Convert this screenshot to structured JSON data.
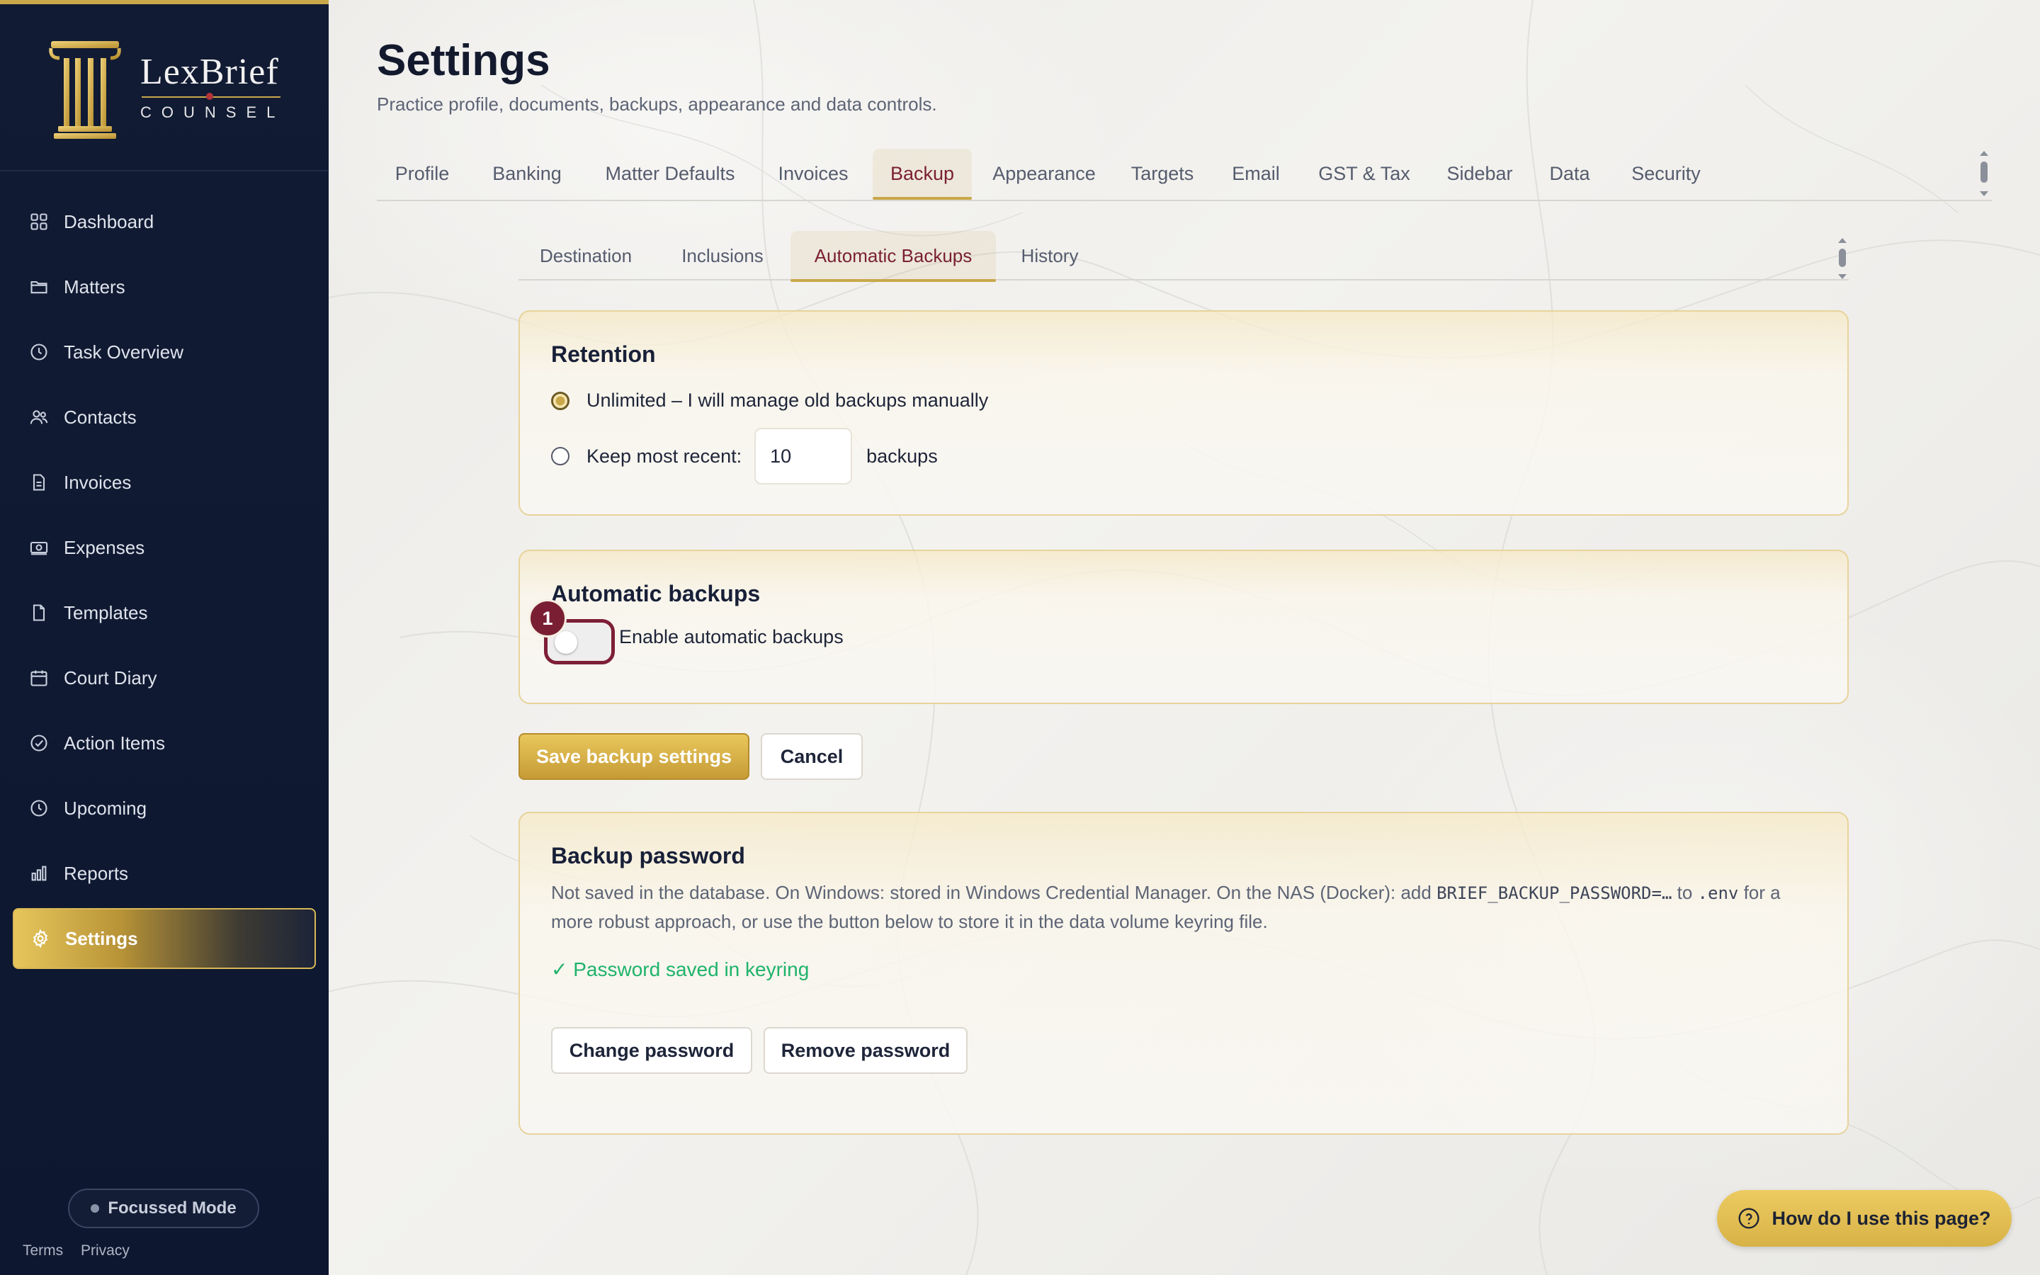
{
  "brand": {
    "name": "LexBrief",
    "sub": "COUNSEL"
  },
  "sidebar": {
    "items": [
      {
        "label": "Dashboard",
        "icon": "grid-icon"
      },
      {
        "label": "Matters",
        "icon": "folder-icon"
      },
      {
        "label": "Task Overview",
        "icon": "clock-icon"
      },
      {
        "label": "Contacts",
        "icon": "users-icon"
      },
      {
        "label": "Invoices",
        "icon": "document-icon"
      },
      {
        "label": "Expenses",
        "icon": "cash-icon"
      },
      {
        "label": "Templates",
        "icon": "file-icon"
      },
      {
        "label": "Court Diary",
        "icon": "calendar-icon"
      },
      {
        "label": "Action Items",
        "icon": "check-circle-icon"
      },
      {
        "label": "Upcoming",
        "icon": "clock-icon"
      },
      {
        "label": "Reports",
        "icon": "bar-chart-icon"
      },
      {
        "label": "Settings",
        "icon": "gear-icon",
        "active": true
      }
    ],
    "focus_mode": "Focussed Mode",
    "terms": "Terms",
    "privacy": "Privacy"
  },
  "header": {
    "title": "Settings",
    "subtitle": "Practice profile, documents, backups, appearance and data controls."
  },
  "tabs": [
    "Profile",
    "Banking",
    "Matter Defaults",
    "Invoices",
    "Backup",
    "Appearance",
    "Targets",
    "Email",
    "GST & Tax",
    "Sidebar",
    "Data",
    "Security"
  ],
  "active_tab": "Backup",
  "subtabs": [
    "Destination",
    "Inclusions",
    "Automatic Backups",
    "History"
  ],
  "active_subtab": "Automatic Backups",
  "retention": {
    "title": "Retention",
    "option_unlimited": "Unlimited – I will manage old backups manually",
    "option_keep": "Keep most recent:",
    "keep_value": "10",
    "keep_suffix": "backups",
    "selected": "unlimited"
  },
  "auto": {
    "title": "Automatic backups",
    "toggle_label": "Enable automatic backups",
    "enabled": false,
    "badge": "1"
  },
  "actions": {
    "save": "Save backup settings",
    "cancel": "Cancel"
  },
  "password": {
    "title": "Backup password",
    "desc_1": "Not saved in the database. On Windows: stored in Windows Credential Manager. On the NAS (Docker): add ",
    "desc_code": "BRIEF_BACKUP_PASSWORD=…",
    "desc_2": " to ",
    "desc_env": ".env",
    "desc_3": " for a more robust approach, or use the button below to store it in the data volume keyring file.",
    "status": "✓ Password saved in keyring",
    "change": "Change password",
    "remove": "Remove password"
  },
  "help": "How do I use this page?",
  "colors": {
    "accent_gold": "#c9a84a",
    "accent_burgundy": "#7a1f33",
    "sidebar_bg": "#111b33",
    "success": "#1fb36b"
  }
}
